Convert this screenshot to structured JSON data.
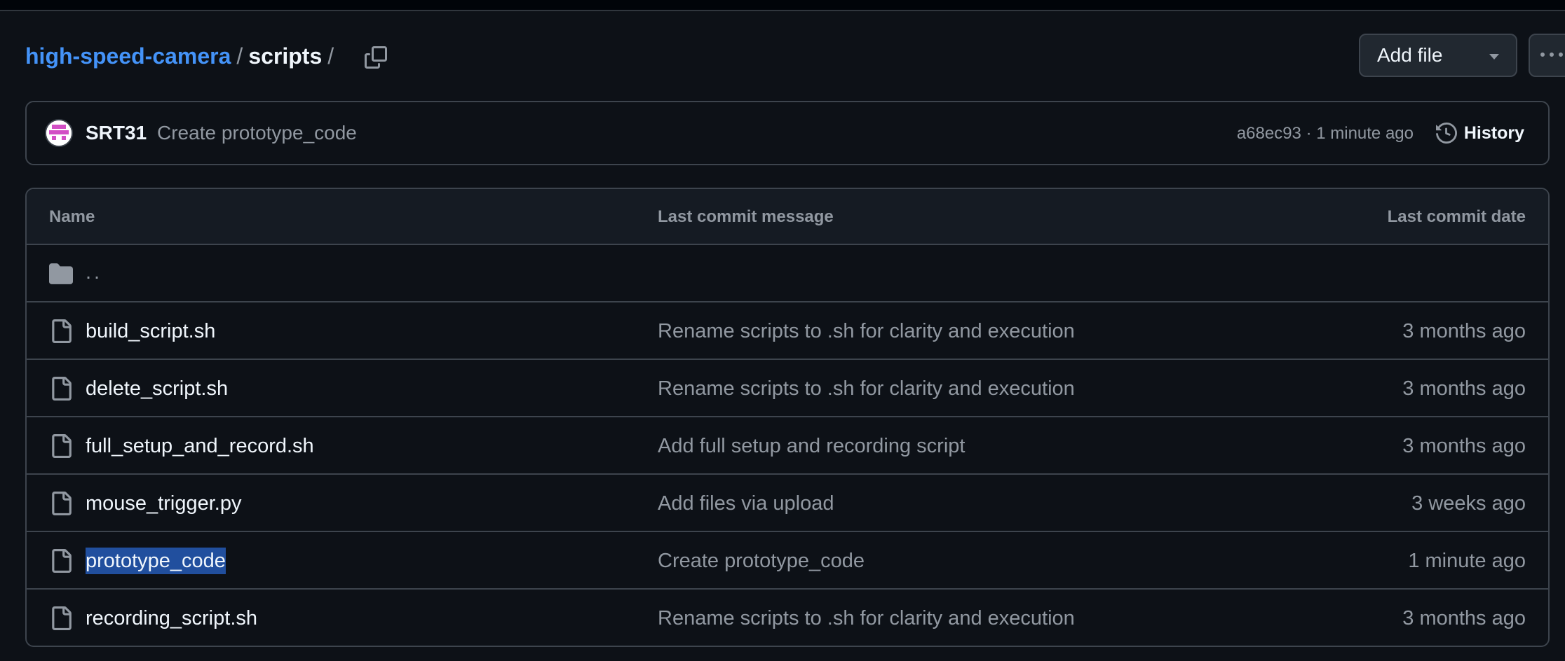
{
  "breadcrumb": {
    "repo": "high-speed-camera",
    "separator": "/",
    "folder": "scripts",
    "trailing_separator": "/"
  },
  "actions": {
    "add_file_label": "Add file",
    "more_icon": "kebab-horizontal-icon",
    "copy_icon": "copy-icon"
  },
  "latest_commit": {
    "author": "SRT31",
    "message": "Create prototype_code",
    "hash": "a68ec93",
    "time": "1 minute ago",
    "meta": "a68ec93 · 1 minute ago",
    "history_label": "History",
    "history_icon": "history-icon"
  },
  "table": {
    "headers": {
      "name": "Name",
      "message": "Last commit message",
      "date": "Last commit date"
    },
    "parent_dir": "..",
    "rows": [
      {
        "name": "build_script.sh",
        "message": "Rename scripts to .sh for clarity and execution",
        "date": "3 months ago",
        "icon": "file-icon"
      },
      {
        "name": "delete_script.sh",
        "message": "Rename scripts to .sh for clarity and execution",
        "date": "3 months ago",
        "icon": "file-icon"
      },
      {
        "name": "full_setup_and_record.sh",
        "message": "Add full setup and recording script",
        "date": "3 months ago",
        "icon": "file-icon"
      },
      {
        "name": "mouse_trigger.py",
        "message": "Add files via upload",
        "date": "3 weeks ago",
        "icon": "file-icon"
      },
      {
        "name": "prototype_code",
        "message": "Create prototype_code",
        "date": "1 minute ago",
        "icon": "file-icon",
        "selected": true
      },
      {
        "name": "recording_script.sh",
        "message": "Rename scripts to .sh for clarity and execution",
        "date": "3 months ago",
        "icon": "file-icon"
      }
    ]
  },
  "colors": {
    "background": "#0d1117",
    "link": "#4493f8",
    "muted": "#9198a1",
    "border": "#3d444d",
    "selection": "#214f9e"
  }
}
